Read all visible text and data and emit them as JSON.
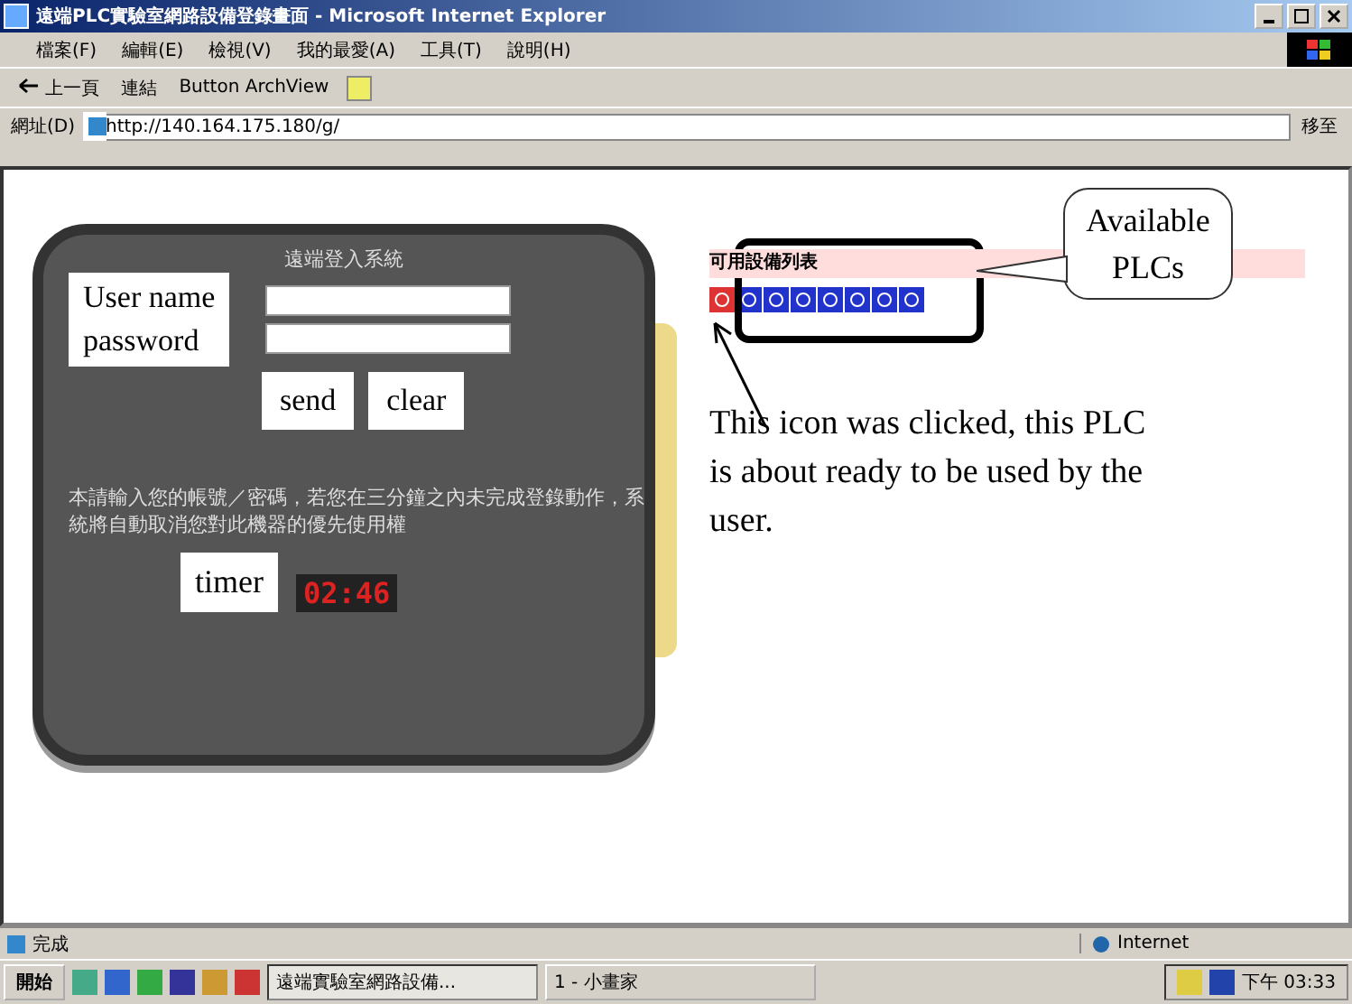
{
  "window": {
    "title": "遠端PLC實驗室網路設備登錄畫面 - Microsoft Internet Explorer"
  },
  "menu": [
    "檔案(F)",
    "編輯(E)",
    "檢視(V)",
    "我的最愛(A)",
    "工具(T)",
    "說明(H)"
  ],
  "toolbar": {
    "back": "上一頁",
    "links": "連結",
    "addon": "Button ArchView"
  },
  "address": {
    "label": "網址(D)",
    "value": "http://140.164.175.180/g/",
    "go": "移至"
  },
  "login": {
    "title": "遠端登入系統",
    "username_label": "User name",
    "password_label": "password",
    "buttons": [
      "send",
      "clear"
    ],
    "notice": "本請輸入您的帳號／密碼，若您在三分鐘之內未完成登錄動作，系統將自動取消您對此機器的優先使用權",
    "timer_label": "timer",
    "timer": "02:46"
  },
  "plc_list": {
    "title": "可用設備列表",
    "items": [
      {
        "selected": true
      },
      {
        "selected": false
      },
      {
        "selected": false
      },
      {
        "selected": false
      },
      {
        "selected": false
      },
      {
        "selected": false
      },
      {
        "selected": false
      },
      {
        "selected": false
      }
    ]
  },
  "annotations": {
    "callout": "Available PLCs",
    "note": "This icon was clicked, this PLC is about ready to be used by the user."
  },
  "status_bar": {
    "text": "完成",
    "zone": "Internet"
  },
  "taskbar": {
    "start": "開始",
    "tasks": [
      {
        "label": "遠端實驗室網路設備...",
        "selected": true
      },
      {
        "label": "1 - 小畫家",
        "selected": false
      }
    ],
    "clock": "下午 03:33"
  }
}
